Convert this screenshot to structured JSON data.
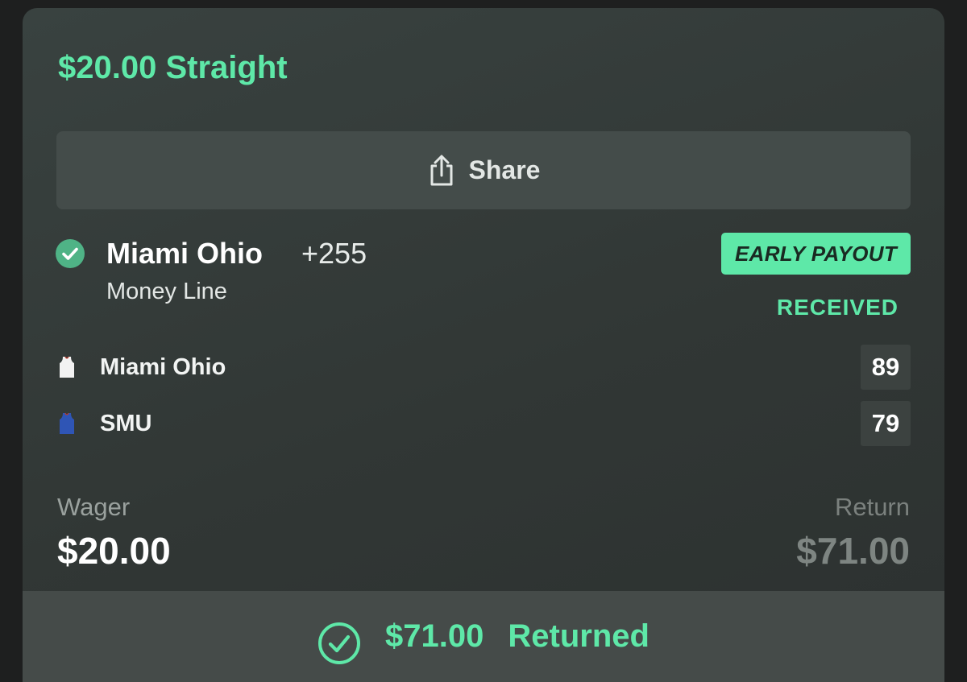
{
  "bet": {
    "title": "$20.00 Straight"
  },
  "share": {
    "label": "Share",
    "icon": "share-icon"
  },
  "selection": {
    "status_icon": "check-circle-icon",
    "name": "Miami Ohio",
    "odds": "+255",
    "market": "Money Line",
    "badge": "EARLY PAYOUT",
    "badge_status": "RECEIVED"
  },
  "teams": [
    {
      "name": "Miami Ohio",
      "score": "89",
      "jersey_color": "#f2f2f2",
      "icon": "jersey-icon"
    },
    {
      "name": "SMU",
      "score": "79",
      "jersey_color": "#2f55b5",
      "icon": "jersey-icon"
    }
  ],
  "summary": {
    "wager_label": "Wager",
    "wager_amount": "$20.00",
    "return_label": "Return",
    "return_amount": "$71.00"
  },
  "footer": {
    "icon": "check-circle-outline-icon",
    "amount": "$71.00",
    "status": "Returned"
  },
  "colors": {
    "accent": "#5ee8a8",
    "card_bg": "#343a38",
    "button_bg": "#444c4a"
  }
}
